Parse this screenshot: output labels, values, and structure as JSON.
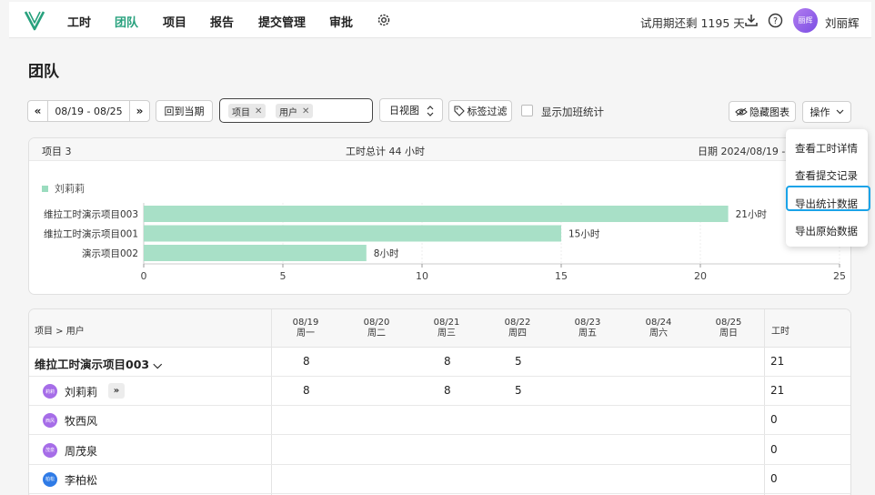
{
  "nav": {
    "items": [
      "工时",
      "团队",
      "项目",
      "报告",
      "提交管理",
      "审批"
    ],
    "active_index": 1,
    "trial_text": "试用期还剩 1195 天",
    "avatar_text": "丽辉",
    "user_name": "刘丽辉"
  },
  "page_title": "团队",
  "toolbar": {
    "prev": "«",
    "date_range": "08/19 - 08/25",
    "next": "»",
    "back_current": "回到当期",
    "filter_tags": [
      "项目",
      "用户"
    ],
    "view_select": "日视图",
    "tag_filter": "标签过滤",
    "overtime_label": "显示加班统计",
    "hide_chart": "隐藏图表",
    "actions": "操作"
  },
  "menu": {
    "items": [
      "查看工时详情",
      "查看提交记录",
      "导出统计数据",
      "导出原始数据"
    ],
    "highlighted_index": 2
  },
  "chart_header": {
    "projects": "项目 3",
    "total": "工时总计 44 小时",
    "date": "日期 2024/08/19 - 2"
  },
  "chart_data": {
    "type": "bar",
    "orientation": "horizontal",
    "categories": [
      "维拉工时演示项目003",
      "维拉工时演示项目001",
      "演示项目002"
    ],
    "series": [
      {
        "name": "刘莉莉",
        "values": [
          21,
          15,
          8
        ],
        "color": "#a8e0c7"
      }
    ],
    "data_labels": [
      "21小时",
      "15小时",
      "8小时"
    ],
    "xlim": [
      0,
      25
    ],
    "xticks": [
      0,
      5,
      10,
      15,
      20,
      25
    ]
  },
  "table": {
    "first_header": "项目 > 用户",
    "days": [
      {
        "date": "08/19",
        "weekday": "周一"
      },
      {
        "date": "08/20",
        "weekday": "周二"
      },
      {
        "date": "08/21",
        "weekday": "周三"
      },
      {
        "date": "08/22",
        "weekday": "周四"
      },
      {
        "date": "08/23",
        "weekday": "周五"
      },
      {
        "date": "08/24",
        "weekday": "周六"
      },
      {
        "date": "08/25",
        "weekday": "周日"
      }
    ],
    "total_header": "工时",
    "rows": [
      {
        "kind": "project",
        "name": "维拉工时演示项目003 ⌵",
        "values": [
          "8",
          "",
          "8",
          "5",
          "",
          "",
          ""
        ],
        "total": "21"
      },
      {
        "kind": "user",
        "avatar": "莉莉",
        "avatar_color": "#a66de8",
        "name": "刘莉莉",
        "expand": "»",
        "values": [
          "8",
          "",
          "8",
          "5",
          "",
          "",
          ""
        ],
        "total": "21"
      },
      {
        "kind": "user",
        "avatar": "西风",
        "avatar_color": "#a66de8",
        "name": "牧西风",
        "values": [
          "",
          "",
          "",
          "",
          "",
          "",
          ""
        ],
        "total": "0"
      },
      {
        "kind": "user",
        "avatar": "茂泉",
        "avatar_color": "#a66de8",
        "name": "周茂泉",
        "values": [
          "",
          "",
          "",
          "",
          "",
          "",
          ""
        ],
        "total": "0"
      },
      {
        "kind": "user",
        "avatar": "柏松",
        "avatar_color": "#2f7be6",
        "name": "李柏松",
        "values": [
          "",
          "",
          "",
          "",
          "",
          "",
          ""
        ],
        "total": "0"
      }
    ]
  }
}
